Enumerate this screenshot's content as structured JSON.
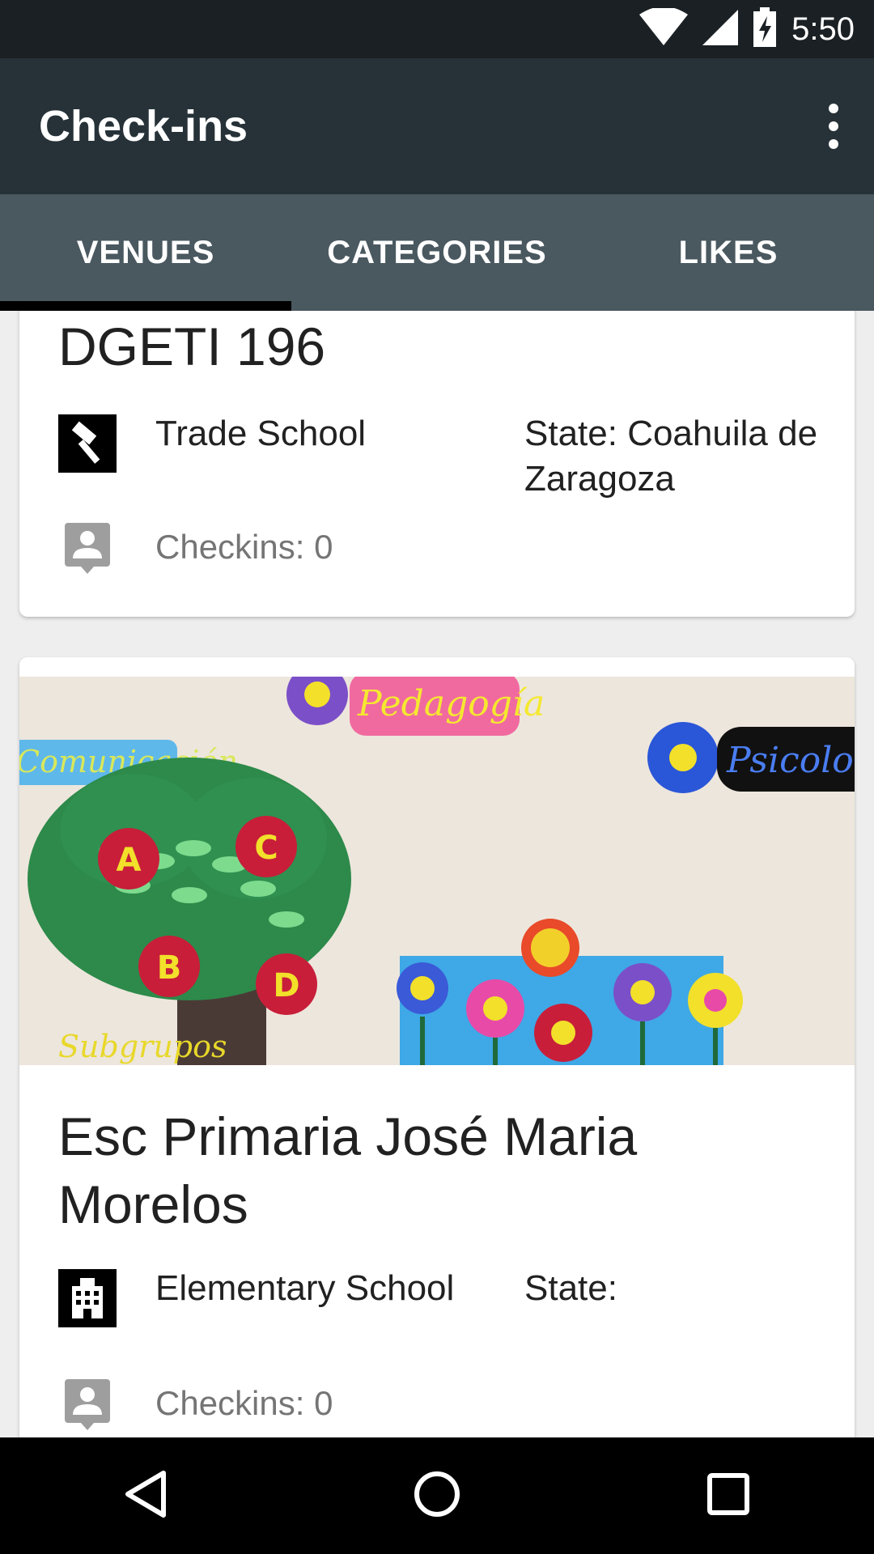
{
  "status_bar": {
    "time": "5:50",
    "icons": [
      "wifi-icon",
      "signal-icon",
      "battery-charging-icon"
    ]
  },
  "app_bar": {
    "title": "Check-ins",
    "menu_icon": "more-vertical-icon"
  },
  "tabs": [
    {
      "label": "VENUES",
      "active": true
    },
    {
      "label": "CATEGORIES",
      "active": false
    },
    {
      "label": "LIKES",
      "active": false
    }
  ],
  "venues": [
    {
      "name": "DGETI 196",
      "category": "Trade School",
      "category_icon": "trade-school-icon",
      "state": "State: Coahuila de Zaragoza",
      "checkins": "Checkins: 0"
    },
    {
      "name": "Esc Primaria José Maria Morelos",
      "category": "Elementary School",
      "category_icon": "elementary-school-icon",
      "state": "State:",
      "checkins": "Checkins: 0",
      "photo_words": {
        "pedagogia": "Pedagogía",
        "comunicacion": "Comunicación",
        "psicologia": "Psicología",
        "subgrupos": "Subgrupos"
      }
    }
  ],
  "nav_bar": {
    "icons": [
      "back-icon",
      "home-icon",
      "recents-icon"
    ]
  },
  "colors": {
    "status_bar": "#1a2024",
    "app_bar": "#263238",
    "tab_bar": "#4a5860",
    "tab_indicator": "#000000"
  }
}
